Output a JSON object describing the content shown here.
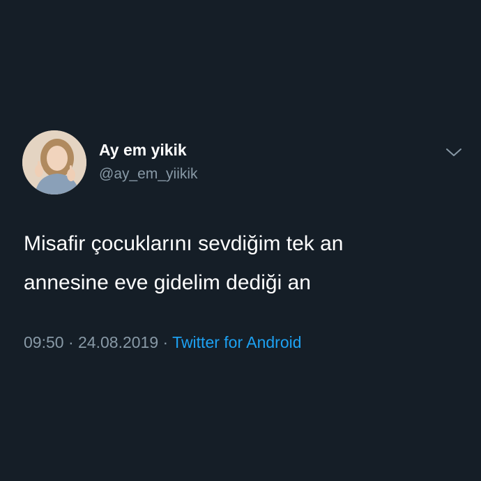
{
  "user": {
    "display_name": "Ay em yikik",
    "handle": "@ay_em_yiikik"
  },
  "tweet": {
    "lines": [
      "Misafir çocuklarını sevdiğim tek an",
      "annesine eve gidelim dediği an"
    ],
    "time": "09:50",
    "separator": " · ",
    "date": "24.08.2019",
    "source": "Twitter for Android"
  },
  "icons": {
    "avatar": "profile-photo",
    "menu": "chevron-down-icon"
  },
  "colors": {
    "background": "#151e27",
    "text": "#ffffff",
    "secondary": "#8899a6",
    "link": "#1da1f2"
  }
}
